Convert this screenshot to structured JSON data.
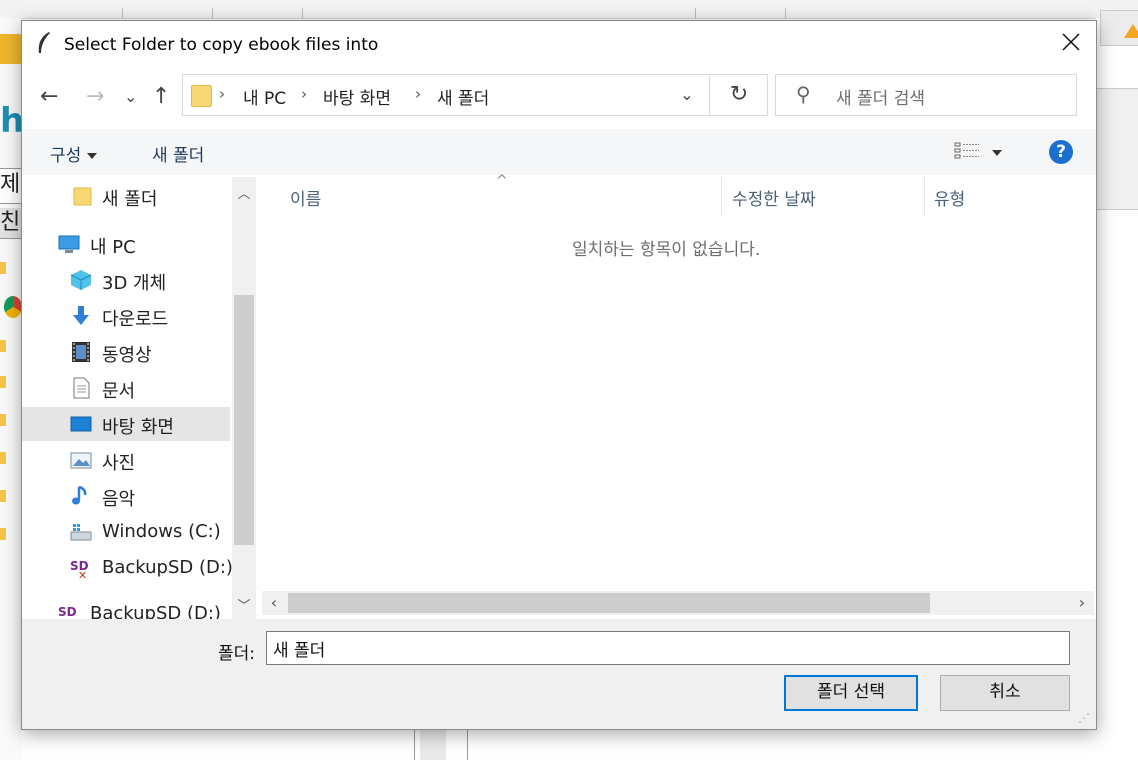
{
  "dialog": {
    "title": "Select Folder to copy ebook files into",
    "close_glyph": "✕"
  },
  "nav": {
    "back_glyph": "←",
    "forward_glyph": "→",
    "recent_glyph": "⌄",
    "up_glyph": "↑",
    "breadcrumb": [
      "내 PC",
      "바탕 화면",
      "새 폴더"
    ],
    "separator": "›",
    "dropdown_glyph": "⌄",
    "refresh_glyph": "↻"
  },
  "search": {
    "placeholder": "새 폴더 검색",
    "icon": "search-icon"
  },
  "commandbar": {
    "organize_label": "구성",
    "new_folder_label": "새 폴더",
    "help_glyph": "?"
  },
  "navpane": {
    "items": [
      {
        "label": "새 폴더",
        "icon": "folder-icon"
      },
      {
        "label": "내 PC",
        "icon": "pc-icon"
      },
      {
        "label": "3D 개체",
        "icon": "cube-icon"
      },
      {
        "label": "다운로드",
        "icon": "download-icon"
      },
      {
        "label": "동영상",
        "icon": "video-icon"
      },
      {
        "label": "문서",
        "icon": "document-icon"
      },
      {
        "label": "바탕 화면",
        "icon": "desktop-icon",
        "selected": true
      },
      {
        "label": "사진",
        "icon": "picture-icon"
      },
      {
        "label": "음악",
        "icon": "music-icon"
      },
      {
        "label": "Windows (C:)",
        "icon": "drive-icon"
      },
      {
        "label": "BackupSD (D:)",
        "icon": "sd-card-icon"
      },
      {
        "label": "BackupSD (D:)",
        "icon": "sd-card-icon"
      }
    ]
  },
  "columns": {
    "name": "이름",
    "modified": "수정한 날짜",
    "type": "유형"
  },
  "content": {
    "empty_message": "일치하는 항목이 없습니다."
  },
  "footer": {
    "folder_label": "폴더:",
    "folder_value": "새 폴더",
    "select_button": "폴더 선택",
    "cancel_button": "취소"
  },
  "background": {
    "left_box_char": "제",
    "left_box2_char": "친",
    "hash_char": "h*"
  },
  "colors": {
    "accent": "#0078d7",
    "selection": "#e5e5e5",
    "help": "#1a6fd0"
  }
}
